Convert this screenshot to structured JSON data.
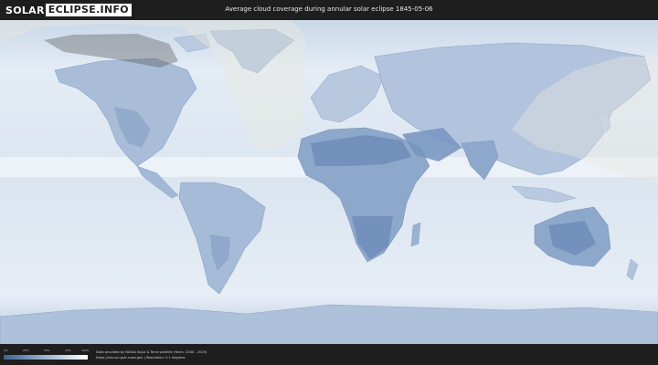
{
  "header": {
    "logo_part1": "SOLAR",
    "logo_part2": "ECLIPSE.INFO",
    "title": "Average cloud coverage during annular solar eclipse 1845-05-06"
  },
  "legend": {
    "ticks": [
      "0%",
      "25%",
      "50%",
      "75%",
      "100%"
    ],
    "color_low": "#3f5f8f",
    "color_high": "#ffffff"
  },
  "footer": {
    "credit_line1": "Data provided by NASAs Aqua & Terra satellite (Years: 2000 - 2019)",
    "credit_line2": "https://neo.sci.gsfc.nasa.gov  |  Resolution: 0.1 degrees"
  },
  "map": {
    "ocean_color": "#d9e4f0",
    "land_clear_color": "#7f9ac0",
    "eclipse_shade_color": "#e8e8e0"
  }
}
